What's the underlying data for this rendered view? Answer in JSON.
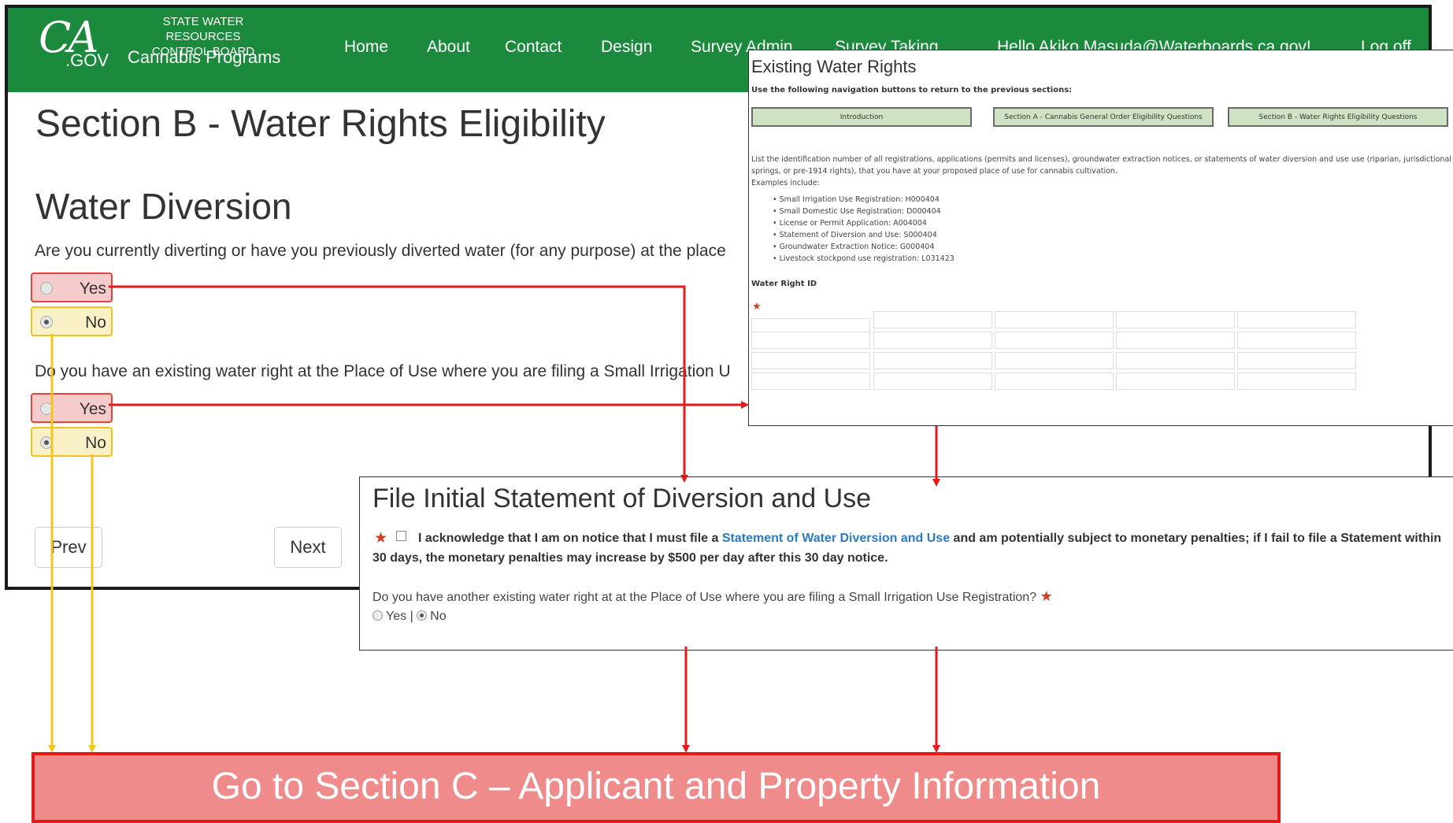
{
  "navbar": {
    "logo_ca": "CA",
    "logo_gov": ".GOV",
    "brand_line1": "STATE WATER RESOURCES",
    "brand_line2": "CONTROL BOARD",
    "brand_name": "Cannabis Programs",
    "items": [
      "Home",
      "About",
      "Contact",
      "Design",
      "Survey Admin",
      "Survey Taking"
    ],
    "greeting": "Hello Akiko.Masuda@Waterboards.ca.gov!",
    "logoff": "Log off",
    "color": "#1c8a3c"
  },
  "main": {
    "section_title": "Section B - Water Rights Eligibility",
    "subsection_title": "Water Diversion",
    "q1": {
      "text": "Are you currently diverting or have you previously diverted water (for any purpose) at the place",
      "options": [
        {
          "label": "Yes",
          "selected": false,
          "highlight": "#e2443c"
        },
        {
          "label": "No",
          "selected": true,
          "highlight": "#f0c21b"
        }
      ]
    },
    "q2": {
      "prefix": "Do",
      "text": "Do you have an existing water right at the Place of Use where you are filing a Small Irrigation U",
      "options": [
        {
          "label": "Yes",
          "selected": false,
          "highlight": "#e2443c"
        },
        {
          "label": "No",
          "selected": true,
          "highlight": "#f0c21b"
        }
      ]
    },
    "prev_label": "Prev",
    "next_label": "Next"
  },
  "existing_water_rights": {
    "title": "Existing Water Rights",
    "nav_instruction": "Use the following navigation buttons to return to the previous sections:",
    "buttons": [
      "Introduction",
      "Section A - Cannabis General Order Eligibility Questions",
      "Section B - Water Rights Eligibility Questions"
    ],
    "instructions": "List the identification number of all registrations, applications (permits and licenses), groundwater extraction notices, or statements of water diversion and use use (riparian, jurisdictional springs, or pre-1914 rights), that you have at your proposed place of use for cannabis cultivation.",
    "examples_label": "Examples include:",
    "examples": [
      "Small Irrigation Use Registration: H000404",
      "Small Domestic Use Registration: D000404",
      "License or Permit Application: A004004",
      "Statement of Diversion and Use: S000404",
      "Groundwater Extraction Notice: G000404",
      "Livestock stockpond use registration: L031423"
    ],
    "water_right_label": "Water Right ID"
  },
  "file_initial_statement": {
    "title": "File Initial Statement of Diversion and Use",
    "ack_before": "I acknowledge that I am on notice that I must file a ",
    "ack_link": "Statement of Water Diversion and Use",
    "ack_after": " and am potentially subject to monetary penalties; if I fail to file a Statement within 30 days, the monetary penalties may increase by $500 per day after this 30 day notice.",
    "question": "Do you have another existing water right at at the Place of Use where you are filing a Small Irrigation Use Registration?",
    "yes": "Yes",
    "separator": "|",
    "no": "No"
  },
  "section_c": {
    "label": "Go to Section C – Applicant and Property Information",
    "fill": "#f08b8b",
    "border": "#e3191b"
  },
  "arrow_colors": {
    "red": "#e3191b",
    "yellow": "#f5c518"
  }
}
